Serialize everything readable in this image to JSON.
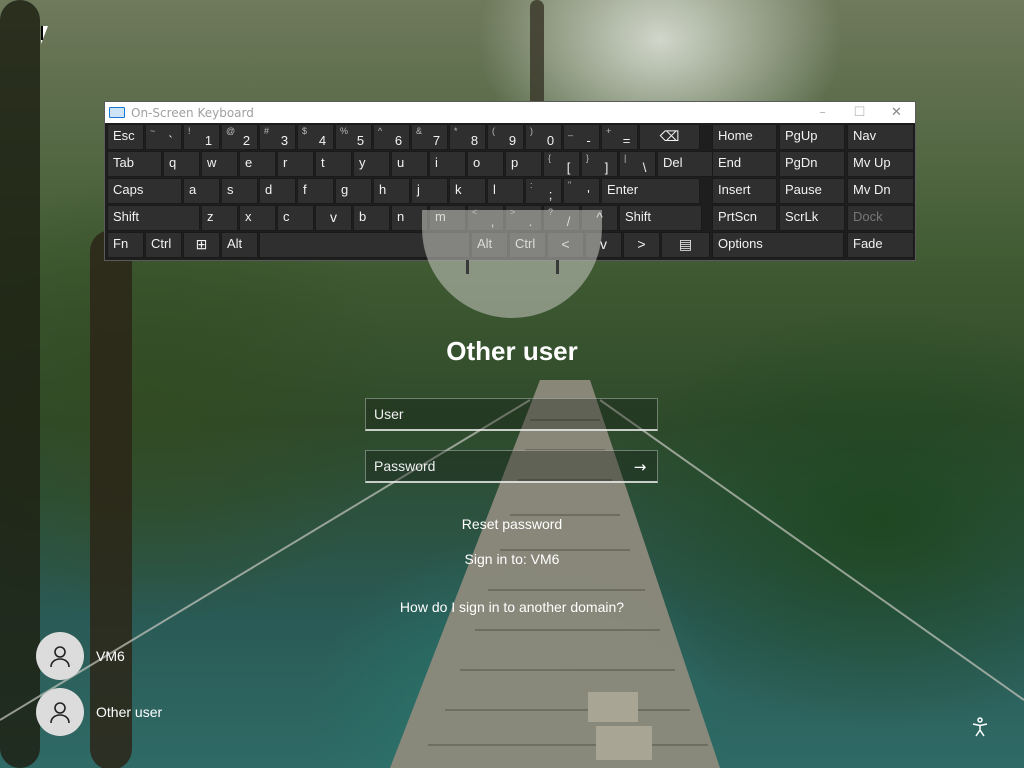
{
  "osk": {
    "title": "On-Screen Keyboard",
    "window_buttons": [
      "–",
      "☐",
      "✕"
    ],
    "rows": [
      [
        {
          "label": "Esc"
        },
        {
          "sub": "~",
          "main": "`"
        },
        {
          "sub": "!",
          "main": "1"
        },
        {
          "sub": "@",
          "main": "2"
        },
        {
          "sub": "#",
          "main": "3"
        },
        {
          "sub": "$",
          "main": "4"
        },
        {
          "sub": "%",
          "main": "5"
        },
        {
          "sub": "^",
          "main": "6"
        },
        {
          "sub": "&",
          "main": "7"
        },
        {
          "sub": "*",
          "main": "8"
        },
        {
          "sub": "(",
          "main": "9"
        },
        {
          "sub": ")",
          "main": "0"
        },
        {
          "sub": "_",
          "main": "-"
        },
        {
          "sub": "+",
          "main": "="
        },
        {
          "label": "⌫"
        }
      ],
      [
        {
          "label": "Tab"
        },
        {
          "label": "q"
        },
        {
          "label": "w"
        },
        {
          "label": "e"
        },
        {
          "label": "r"
        },
        {
          "label": "t"
        },
        {
          "label": "y"
        },
        {
          "label": "u"
        },
        {
          "label": "i"
        },
        {
          "label": "o"
        },
        {
          "label": "p"
        },
        {
          "sub": "{",
          "main": "["
        },
        {
          "sub": "}",
          "main": "]"
        },
        {
          "sub": "|",
          "main": "\\"
        },
        {
          "label": "Del"
        }
      ],
      [
        {
          "label": "Caps"
        },
        {
          "label": "a"
        },
        {
          "label": "s"
        },
        {
          "label": "d"
        },
        {
          "label": "f"
        },
        {
          "label": "g"
        },
        {
          "label": "h"
        },
        {
          "label": "j"
        },
        {
          "label": "k"
        },
        {
          "label": "l"
        },
        {
          "sub": ":",
          "main": ";"
        },
        {
          "sub": "\"",
          "main": "'"
        },
        {
          "label": "Enter"
        }
      ],
      [
        {
          "label": "Shift"
        },
        {
          "label": "z"
        },
        {
          "label": "x"
        },
        {
          "label": "c"
        },
        {
          "label": "v"
        },
        {
          "label": "b"
        },
        {
          "label": "n"
        },
        {
          "label": "m"
        },
        {
          "sub": "<",
          "main": ","
        },
        {
          "sub": ">",
          "main": "."
        },
        {
          "sub": "?",
          "main": "/"
        },
        {
          "label": "^"
        },
        {
          "label": "Shift"
        }
      ],
      [
        {
          "label": "Fn"
        },
        {
          "label": "Ctrl"
        },
        {
          "label": "⊞"
        },
        {
          "label": "Alt"
        },
        {
          "label": ""
        },
        {
          "label": "Alt"
        },
        {
          "label": "Ctrl"
        },
        {
          "label": "<"
        },
        {
          "label": "v"
        },
        {
          "label": ">"
        },
        {
          "label": "▤"
        }
      ]
    ],
    "nav_keys": [
      [
        "Home",
        "PgUp",
        "Nav"
      ],
      [
        "End",
        "PgDn",
        "Mv Up"
      ],
      [
        "Insert",
        "Pause",
        "Mv Dn"
      ],
      [
        "PrtScn",
        "ScrLk",
        "Dock"
      ],
      [
        "Options",
        "Fade"
      ]
    ]
  },
  "signin": {
    "title": "Other user",
    "user_placeholder": "User",
    "password_placeholder": "Password",
    "submit_arrow": "→",
    "reset_password": "Reset password",
    "sign_in_to": "Sign in to: VM6",
    "other_domain": "How do I sign in to another domain?"
  },
  "users": [
    {
      "name": "VM6"
    },
    {
      "name": "Other user"
    }
  ],
  "icons": {
    "accessibility": "accessibility-icon",
    "user": "user-icon",
    "keyboard": "keyboard-icon"
  }
}
